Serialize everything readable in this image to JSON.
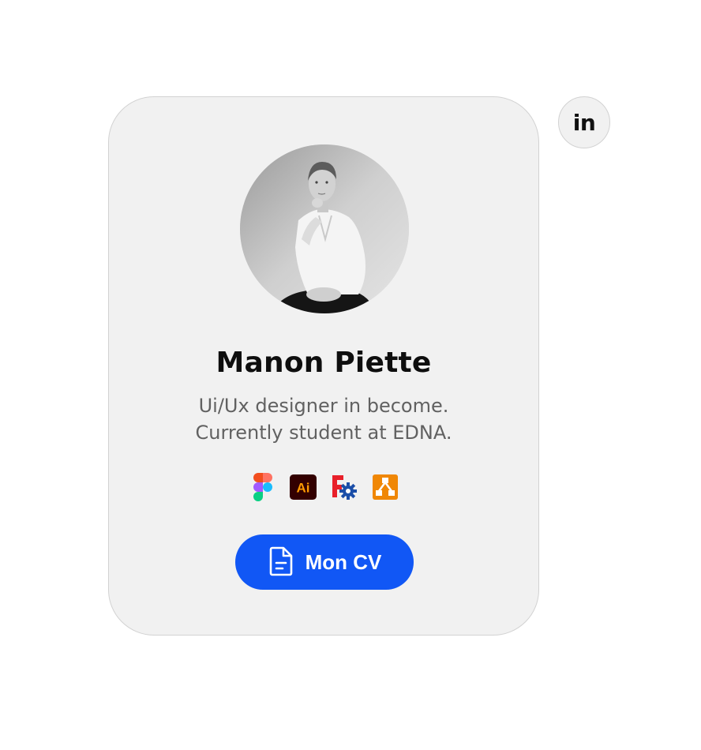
{
  "profile": {
    "name": "Manon Piette",
    "bio_line1": "Ui/Ux designer in become.",
    "bio_line2": "Currently student at EDNA.",
    "photo": "profile-photo (black and white portrait)"
  },
  "tools": [
    {
      "name": "figma-icon"
    },
    {
      "name": "adobe-illustrator-icon",
      "label": "Ai"
    },
    {
      "name": "jetbrains-fleet-icon"
    },
    {
      "name": "drawio-icon"
    }
  ],
  "cv_button": {
    "label": "Mon CV",
    "icon": "document-icon",
    "color": "#1157f5"
  },
  "social": {
    "linkedin_label": "in"
  },
  "colors": {
    "card_bg": "#f1f1f1",
    "card_border": "#d2d2d2",
    "accent": "#1157f5",
    "text_primary": "#0e0e0e",
    "text_secondary": "#616161"
  }
}
